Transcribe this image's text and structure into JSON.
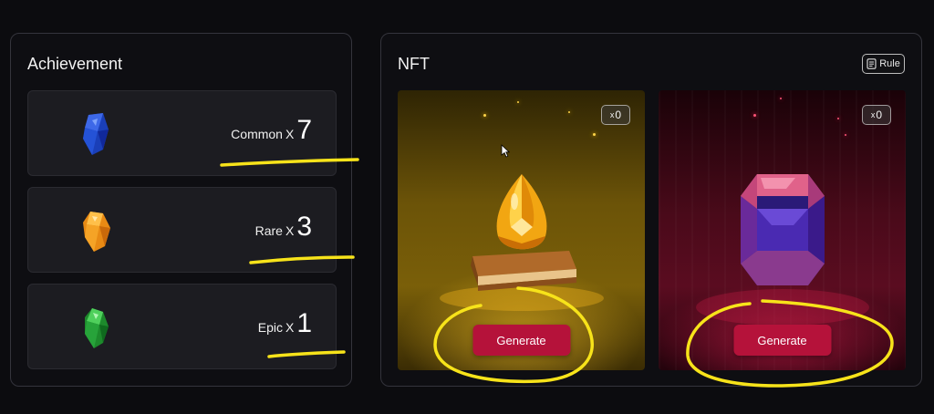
{
  "achievement": {
    "title": "Achievement",
    "items": [
      {
        "name": "Common",
        "x": "X",
        "count": "7",
        "gem": "blue-gem-icon",
        "color": "#1f44c8"
      },
      {
        "name": "Rare",
        "x": "X",
        "count": "3",
        "gem": "orange-gem-icon",
        "color": "#f09a1c"
      },
      {
        "name": "Epic",
        "x": "X",
        "count": "1",
        "gem": "green-gem-icon",
        "color": "#1e8a2e"
      }
    ]
  },
  "nft": {
    "title": "NFT",
    "rule_label": "Rule",
    "rule_icon": "document-icon",
    "cards": [
      {
        "badge_x": "x",
        "badge_count": "0",
        "button": "Generate",
        "art": "golden-gem-on-book-image"
      },
      {
        "badge_x": "x",
        "badge_count": "0",
        "button": "Generate",
        "art": "purple-crystal-image"
      }
    ]
  },
  "colors": {
    "background": "#0c0c0f",
    "panel_border": "#34343c",
    "button": "#b5123a",
    "annotation": "#f7e31a"
  }
}
